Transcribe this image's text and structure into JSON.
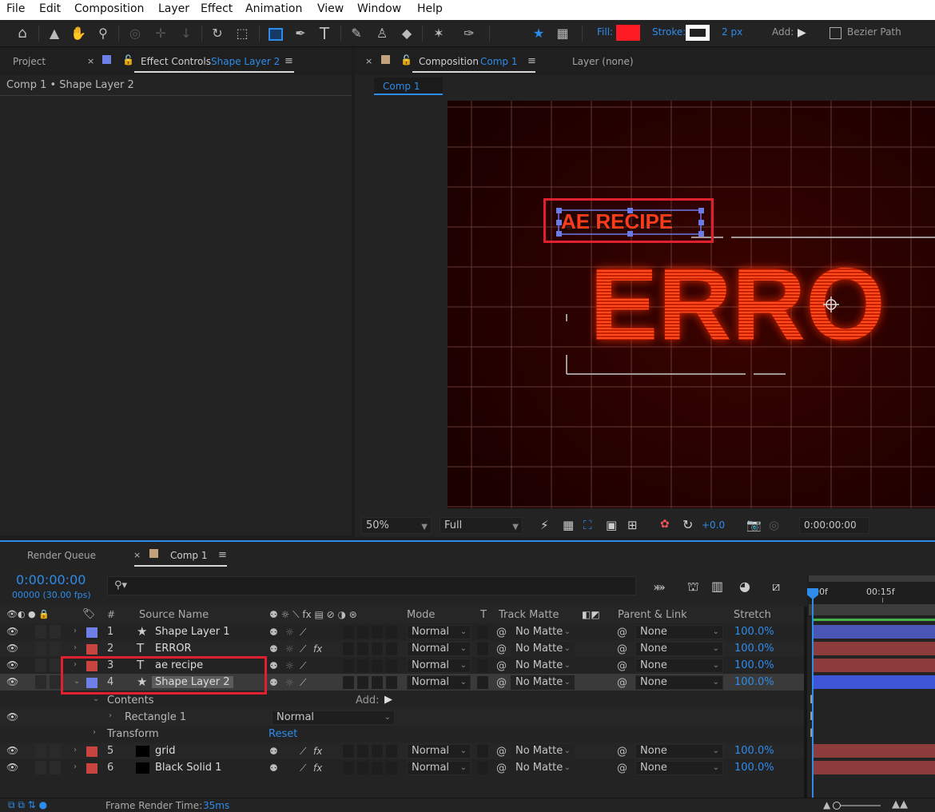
{
  "menu": [
    "File",
    "Edit",
    "Composition",
    "Layer",
    "Effect",
    "Animation",
    "View",
    "Window",
    "Help"
  ],
  "toolbar": {
    "fill_label": "Fill:",
    "fill_color": "#ff1b24",
    "stroke_label": "Stroke:",
    "stroke_width": "2 px",
    "add_label": "Add:",
    "bezier_label": "Bezier Path"
  },
  "left_panel": {
    "project_tab": "Project",
    "effect_controls_tab": "Effect Controls",
    "effect_controls_layer": "Shape Layer 2",
    "breadcrumb": "Comp 1 • Shape Layer 2"
  },
  "comp_panel": {
    "composition_tab": "Composition",
    "comp_name": "Comp 1",
    "layer_tab": "Layer (none)",
    "comp_chip": "Comp 1",
    "viewer": {
      "small_text": "AE RECIPE",
      "big_text": "ERRO",
      "background": "#220000",
      "glow_color": "#ff3a1a"
    },
    "footer": {
      "zoom": "50%",
      "resolution": "Full",
      "exposure": "+0.0",
      "timecode": "0:00:00:00"
    }
  },
  "timeline": {
    "render_queue_tab": "Render Queue",
    "comp_tab": "Comp 1",
    "current_time": "0:00:00:00",
    "frame_info": "00000 (30.00 fps)",
    "search_placeholder": "",
    "ruler": [
      "00f",
      "00:15f"
    ],
    "columns": {
      "num": "#",
      "source_name": "Source Name",
      "mode": "Mode",
      "t": "T",
      "track_matte": "Track Matte",
      "parent_link": "Parent & Link",
      "stretch": "Stretch"
    },
    "layers": [
      {
        "num": "1",
        "icon": "star",
        "name": "Shape Layer 1",
        "mode": "Normal",
        "matte": "No Matte",
        "parent": "None",
        "stretch": "100.0%",
        "label_color": "#6f7fe8",
        "fx": false,
        "expanded": false
      },
      {
        "num": "2",
        "icon": "T",
        "name": "ERROR",
        "mode": "Normal",
        "matte": "No Matte",
        "parent": "None",
        "stretch": "100.0%",
        "label_color": "#c8443e",
        "fx": true,
        "expanded": false
      },
      {
        "num": "3",
        "icon": "T",
        "name": "ae recipe",
        "mode": "Normal",
        "matte": "No Matte",
        "parent": "None",
        "stretch": "100.0%",
        "label_color": "#c8443e",
        "fx": false,
        "expanded": false
      },
      {
        "num": "4",
        "icon": "star",
        "name": "Shape Layer 2",
        "mode": "Normal",
        "matte": "No Matte",
        "parent": "None",
        "stretch": "100.0%",
        "label_color": "#6f7fe8",
        "fx": false,
        "expanded": true
      }
    ],
    "contents": {
      "label": "Contents",
      "add_label": "Add:",
      "rect_label": "Rectangle 1",
      "rect_mode": "Normal",
      "transform_label": "Transform",
      "reset_label": "Reset"
    },
    "layers2": [
      {
        "num": "5",
        "name": "grid",
        "mode": "Normal",
        "matte": "No Matte",
        "parent": "None",
        "stretch": "100.0%",
        "label_color": "#c8443e",
        "fx": true
      },
      {
        "num": "6",
        "name": "Black Solid 1",
        "mode": "Normal",
        "matte": "No Matte",
        "parent": "None",
        "stretch": "100.0%",
        "label_color": "#c8443e",
        "fx": true
      }
    ],
    "status": {
      "frame_render_label": "Frame Render Time:",
      "frame_render_value": "35ms"
    }
  },
  "icons": [
    "home-icon",
    "selection-icon",
    "hand-icon",
    "zoom-icon",
    "rotate-icon",
    "rectangle-icon",
    "pen-icon",
    "type-icon",
    "brush-icon",
    "eraser-icon",
    "puppet-icon",
    "snapping-icon",
    "eye-icon",
    "lock-icon",
    "label-icon"
  ]
}
